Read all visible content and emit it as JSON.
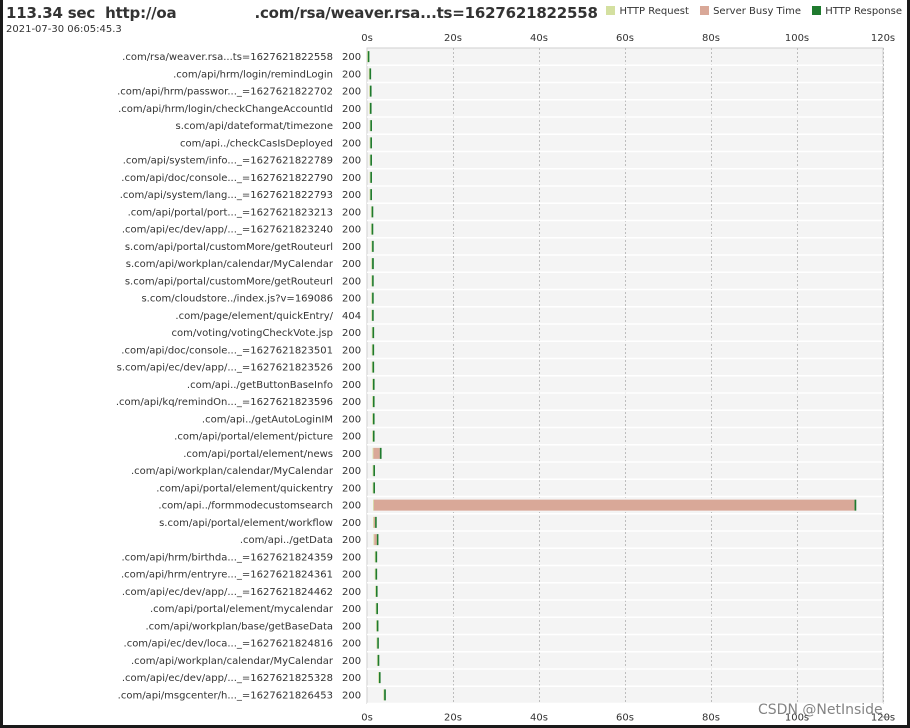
{
  "header": {
    "duration": "113.34 sec",
    "url_prefix": "http://oa",
    "url_suffix": ".com/rsa/weaver.rsa...ts=1627621822558",
    "timestamp": "2021-07-30 06:05:45.3"
  },
  "legend": [
    {
      "label": "HTTP Request",
      "color": "#d4e0a0"
    },
    {
      "label": "Server Busy Time",
      "color": "#d9a898"
    },
    {
      "label": "HTTP Response",
      "color": "#1f7a2e"
    }
  ],
  "watermark": "CSDN @NetInside_",
  "chart_data": {
    "type": "bar",
    "orientation": "horizontal-timeline",
    "title": "",
    "xlabel": "",
    "ylabel": "",
    "xlim": [
      0,
      120
    ],
    "x_ticks": [
      "0s",
      "20s",
      "40s",
      "60s",
      "80s",
      "100s",
      "120s"
    ],
    "x_tick_values": [
      0,
      20,
      40,
      60,
      80,
      100,
      120
    ],
    "grid": true,
    "legend_position": "top-right",
    "series_names": [
      "HTTP Request",
      "Server Busy Time",
      "HTTP Response"
    ],
    "rows": [
      {
        "label": ".com/rsa/weaver.rsa...ts=1627621822558",
        "status": "200",
        "start": 0.0,
        "busy": 0.0,
        "response": 0.3
      },
      {
        "label": ".com/api/hrm/login/remindLogin",
        "status": "200",
        "start": 0.4,
        "busy": 0.0,
        "response": 0.3
      },
      {
        "label": ".com/api/hrm/passwor..._=1627621822702",
        "status": "200",
        "start": 0.5,
        "busy": 0.0,
        "response": 0.3
      },
      {
        "label": ".com/api/hrm/login/checkChangeAccountId",
        "status": "200",
        "start": 0.5,
        "busy": 0.0,
        "response": 0.3
      },
      {
        "label": "s.com/api/dateformat/timezone",
        "status": "200",
        "start": 0.6,
        "busy": 0.0,
        "response": 0.3
      },
      {
        "label": "com/api../checkCasIsDeployed",
        "status": "200",
        "start": 0.6,
        "busy": 0.0,
        "response": 0.3
      },
      {
        "label": ".com/api/system/info..._=1627621822789",
        "status": "200",
        "start": 0.6,
        "busy": 0.0,
        "response": 0.3
      },
      {
        "label": ".com/api/doc/console..._=1627621822790",
        "status": "200",
        "start": 0.6,
        "busy": 0.0,
        "response": 0.3
      },
      {
        "label": ".com/api/system/lang..._=1627621822793",
        "status": "200",
        "start": 0.6,
        "busy": 0.0,
        "response": 0.3
      },
      {
        "label": ".com/api/portal/port..._=1627621823213",
        "status": "200",
        "start": 0.9,
        "busy": 0.0,
        "response": 0.3
      },
      {
        "label": ".com/api/ec/dev/app/..._=1627621823240",
        "status": "200",
        "start": 0.9,
        "busy": 0.0,
        "response": 0.3
      },
      {
        "label": "s.com/api/portal/customMore/getRouteurl",
        "status": "200",
        "start": 1.0,
        "busy": 0.0,
        "response": 0.3
      },
      {
        "label": "s.com/api/workplan/calendar/MyCalendar",
        "status": "200",
        "start": 1.0,
        "busy": 0.0,
        "response": 0.4
      },
      {
        "label": "s.com/api/portal/customMore/getRouteurl",
        "status": "200",
        "start": 1.0,
        "busy": 0.0,
        "response": 0.3
      },
      {
        "label": "s.com/cloudstore../index.js?v=169086",
        "status": "200",
        "start": 1.0,
        "busy": 0.0,
        "response": 0.3
      },
      {
        "label": ".com/page/element/quickEntry/",
        "status": "404",
        "start": 1.0,
        "busy": 0.0,
        "response": 0.3
      },
      {
        "label": "com/voting/votingCheckVote.jsp",
        "status": "200",
        "start": 1.1,
        "busy": 0.0,
        "response": 0.3
      },
      {
        "label": ".com/api/doc/console..._=1627621823501",
        "status": "200",
        "start": 1.1,
        "busy": 0.0,
        "response": 0.3
      },
      {
        "label": "s.com/api/ec/dev/app/..._=1627621823526",
        "status": "200",
        "start": 1.1,
        "busy": 0.0,
        "response": 0.3
      },
      {
        "label": ".com/api../getButtonBaseInfo",
        "status": "200",
        "start": 1.2,
        "busy": 0.0,
        "response": 0.3
      },
      {
        "label": ".com/api/kq/remindOn..._=1627621823596",
        "status": "200",
        "start": 1.2,
        "busy": 0.0,
        "response": 0.3
      },
      {
        "label": ".com/api../getAutoLoginIM",
        "status": "200",
        "start": 1.2,
        "busy": 0.0,
        "response": 0.3
      },
      {
        "label": ".com/api/portal/element/picture",
        "status": "200",
        "start": 1.2,
        "busy": 0.0,
        "response": 0.3
      },
      {
        "label": ".com/api/portal/element/news",
        "status": "200",
        "start": 1.3,
        "busy": 1.5,
        "response": 0.4
      },
      {
        "label": ".com/api/workplan/calendar/MyCalendar",
        "status": "200",
        "start": 1.3,
        "busy": 0.0,
        "response": 0.3
      },
      {
        "label": ".com/api/portal/element/quickentry",
        "status": "200",
        "start": 1.3,
        "busy": 0.0,
        "response": 0.3
      },
      {
        "label": ".com/api../formmodecustomsearch",
        "status": "200",
        "start": 1.4,
        "busy": 111.8,
        "response": 0.4
      },
      {
        "label": "s.com/api/portal/element/workflow",
        "status": "200",
        "start": 1.4,
        "busy": 0.3,
        "response": 0.3
      },
      {
        "label": ".com/api../getData",
        "status": "200",
        "start": 1.5,
        "busy": 0.6,
        "response": 0.3
      },
      {
        "label": ".com/api/hrm/birthda..._=1627621824359",
        "status": "200",
        "start": 1.8,
        "busy": 0.0,
        "response": 0.3
      },
      {
        "label": ".com/api/hrm/entryre..._=1627621824361",
        "status": "200",
        "start": 1.8,
        "busy": 0.0,
        "response": 0.3
      },
      {
        "label": ".com/api/ec/dev/app/..._=1627621824462",
        "status": "200",
        "start": 1.9,
        "busy": 0.0,
        "response": 0.3
      },
      {
        "label": ".com/api/portal/element/mycalendar",
        "status": "200",
        "start": 2.0,
        "busy": 0.0,
        "response": 0.3
      },
      {
        "label": ".com/api/workplan/base/getBaseData",
        "status": "200",
        "start": 2.1,
        "busy": 0.0,
        "response": 0.3
      },
      {
        "label": ".com/api/ec/dev/loca..._=1627621824816",
        "status": "200",
        "start": 2.2,
        "busy": 0.0,
        "response": 0.3
      },
      {
        "label": ".com/api/workplan/calendar/MyCalendar",
        "status": "200",
        "start": 2.3,
        "busy": 0.0,
        "response": 0.3
      },
      {
        "label": ".com/api/ec/dev/app/..._=1627621825328",
        "status": "200",
        "start": 2.6,
        "busy": 0.0,
        "response": 0.3
      },
      {
        "label": ".com/api/msgcenter/h..._=1627621826453",
        "status": "200",
        "start": 3.8,
        "busy": 0.0,
        "response": 0.4
      }
    ]
  }
}
